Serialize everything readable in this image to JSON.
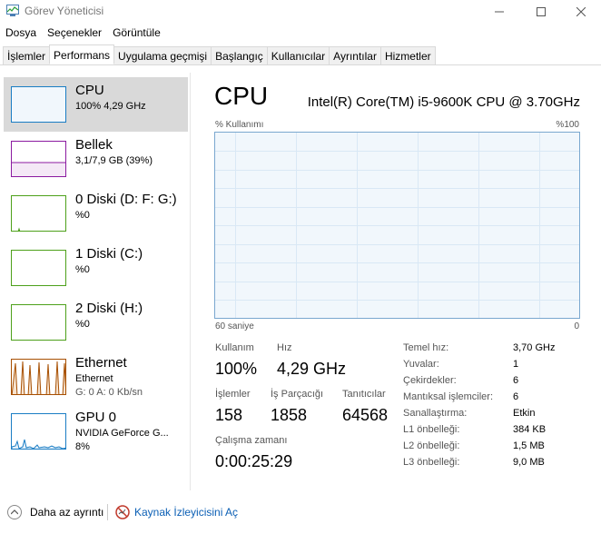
{
  "window": {
    "title": "Görev Yöneticisi",
    "icon": "task-manager-icon"
  },
  "menu": [
    "Dosya",
    "Seçenekler",
    "Görüntüle"
  ],
  "tabs": [
    {
      "label": "İşlemler",
      "active": false
    },
    {
      "label": "Performans",
      "active": true
    },
    {
      "label": "Uygulama geçmişi",
      "active": false
    },
    {
      "label": "Başlangıç",
      "active": false
    },
    {
      "label": "Kullanıcılar",
      "active": false
    },
    {
      "label": "Ayrıntılar",
      "active": false
    },
    {
      "label": "Hizmetler",
      "active": false
    }
  ],
  "sidebar": [
    {
      "title": "CPU",
      "sub1": "100%  4,29 GHz",
      "sub2": "",
      "color": "#1a7dc4",
      "selected": true
    },
    {
      "title": "Bellek",
      "sub1": "3,1/7,9 GB (39%)",
      "sub2": "",
      "color": "#8b1aa0",
      "selected": false
    },
    {
      "title": "0 Diski (D: F: G:)",
      "sub1": "%0",
      "sub2": "",
      "color": "#4da01a",
      "selected": false
    },
    {
      "title": "1 Diski (C:)",
      "sub1": "%0",
      "sub2": "",
      "color": "#4da01a",
      "selected": false
    },
    {
      "title": "2 Diski (H:)",
      "sub1": "%0",
      "sub2": "",
      "color": "#4da01a",
      "selected": false
    },
    {
      "title": "Ethernet",
      "sub1": "Ethernet",
      "sub2": "G: 0  A: 0 Kb/sn",
      "color": "#a74f01",
      "selected": false
    },
    {
      "title": "GPU 0",
      "sub1": "NVIDIA GeForce G...",
      "sub2": "8%",
      "color": "#1a7dc4",
      "selected": false
    }
  ],
  "main": {
    "heading": "CPU",
    "model": "Intel(R) Core(TM) i5-9600K CPU @ 3.70GHz",
    "graph_label_left": "% Kullanımı",
    "graph_label_right": "%100",
    "graph_bottom_left": "60 saniye",
    "graph_bottom_right": "0",
    "usage_label": "Kullanım",
    "usage_value": "100%",
    "speed_label": "Hız",
    "speed_value": "4,29 GHz",
    "processes_label": "İşlemler",
    "processes_value": "158",
    "threads_label": "İş Parçacığı",
    "threads_value": "1858",
    "handles_label": "Tanıtıcılar",
    "handles_value": "64568",
    "uptime_label": "Çalışma zamanı",
    "uptime_value": "0:00:25:29",
    "specs": [
      {
        "label": "Temel hız:",
        "value": "3,70 GHz"
      },
      {
        "label": "Yuvalar:",
        "value": "1"
      },
      {
        "label": "Çekirdekler:",
        "value": "6"
      },
      {
        "label": "Mantıksal işlemciler:",
        "value": "6"
      },
      {
        "label": "Sanallaştırma:",
        "value": "Etkin"
      },
      {
        "label": "L1 önbelleği:",
        "value": "384 KB"
      },
      {
        "label": "L2 önbelleği:",
        "value": "1,5 MB"
      },
      {
        "label": "L3 önbelleği:",
        "value": "9,0 MB"
      }
    ]
  },
  "footer": {
    "less_detail": "Daha az ayrıntı",
    "resource_monitor": "Kaynak İzleyicisini Aç"
  }
}
